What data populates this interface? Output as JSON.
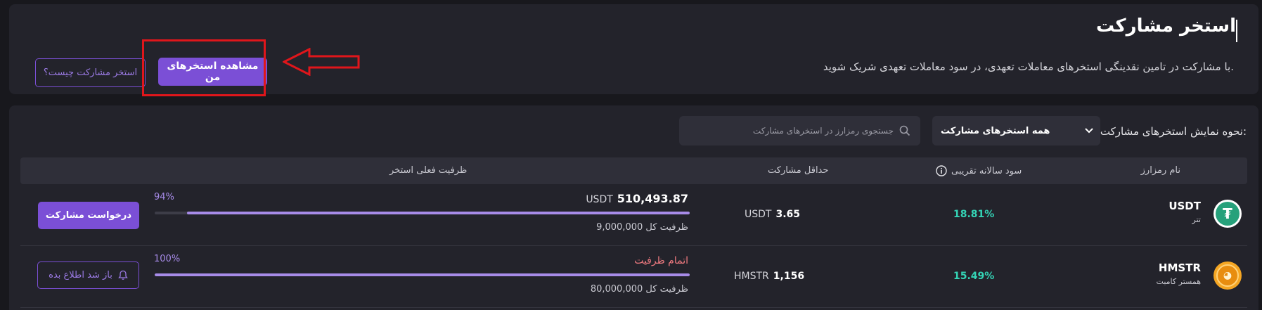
{
  "header": {
    "title": "استخر مشارکت",
    "description": "با مشارکت در تامین نقدینگی استخرهای معاملات تعهدی، در سود معاملات تعهدی شریک شوید.",
    "my_pools_button": "مشاهده استخرهای من",
    "what_is_button": "استخر مشارکت چیست؟",
    "highlight_color": "#e0161b"
  },
  "filters": {
    "view_label": "نحوه نمایش استخرهای مشارکت:",
    "select_value": "همه استخرهای مشارکت",
    "search_placeholder": "جستجوی رمزارز در استخرهای مشارکت"
  },
  "table": {
    "headers": {
      "coin": "نام رمزارز",
      "apy": "سود سالانه تقریبی",
      "min": "حداقل مشارکت",
      "capacity": "ظرفیت فعلی استخر"
    },
    "rows": [
      {
        "symbol": "USDT",
        "name": "تتر",
        "icon": "tether-icon",
        "apy": "18.81%",
        "min_value": "3.65",
        "min_unit": "USDT",
        "current_value": "510,493.87",
        "current_unit": "USDT",
        "percent": "94%",
        "fill": 94,
        "total_label": "ظرفیت کل 9,000,000",
        "action": "درخواست مشارکت"
      },
      {
        "symbol": "HMSTR",
        "name": "همستر کامبت",
        "icon": "hamster-icon",
        "apy": "15.49%",
        "min_value": "1,156",
        "min_unit": "HMSTR",
        "status": "اتمام ظرفیت",
        "percent": "100%",
        "fill": 100,
        "total_label": "ظرفیت کل 80,000,000",
        "action": "باز شد اطلاع بده"
      }
    ]
  },
  "colors": {
    "accent": "#7b4fd6",
    "progress": "#a78be8",
    "apy": "#34d3b5",
    "full": "#f07a80"
  }
}
